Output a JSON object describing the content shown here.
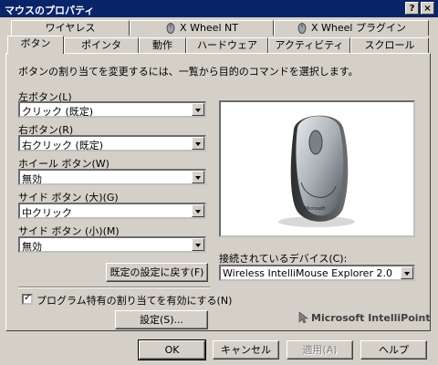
{
  "window": {
    "title": "マウスのプロパティ",
    "help_btn": "?",
    "close_btn": "×"
  },
  "tabs_row1": [
    {
      "label": "ワイヤレス"
    },
    {
      "label": "X Wheel NT"
    },
    {
      "label": "X Wheel プラグイン"
    }
  ],
  "tabs_row2": [
    {
      "label": "ボタン"
    },
    {
      "label": "ポインタ"
    },
    {
      "label": "動作"
    },
    {
      "label": "ハードウェア"
    },
    {
      "label": "アクティビティ"
    },
    {
      "label": "スクロール"
    }
  ],
  "instruction": "ボタンの割り当てを変更するには、一覧から目的のコマンドを選択します。",
  "buttons": {
    "left": {
      "label": "左ボタン(L)",
      "value": "クリック (既定)"
    },
    "right": {
      "label": "右ボタン(R)",
      "value": "右クリック (既定)"
    },
    "wheel": {
      "label": "ホイール ボタン(W)",
      "value": "無効"
    },
    "side_large": {
      "label": "サイド ボタン (大)(G)",
      "value": "中クリック"
    },
    "side_small": {
      "label": "サイド ボタン (小)(M)",
      "value": "無効"
    }
  },
  "restore_defaults": "既定の設定に戻す(F)",
  "device": {
    "label": "接続されているデバイス(C):",
    "value": "Wireless IntelliMouse Explorer 2.0"
  },
  "program_specific": {
    "label": "プログラム特有の割り当てを有効にする(N)",
    "checked": true
  },
  "settings_button": "設定(S)...",
  "brand": "Microsoft IntelliPoint",
  "footer": {
    "ok": "OK",
    "cancel": "キャンセル",
    "apply": "適用(A)",
    "help": "ヘルプ"
  }
}
